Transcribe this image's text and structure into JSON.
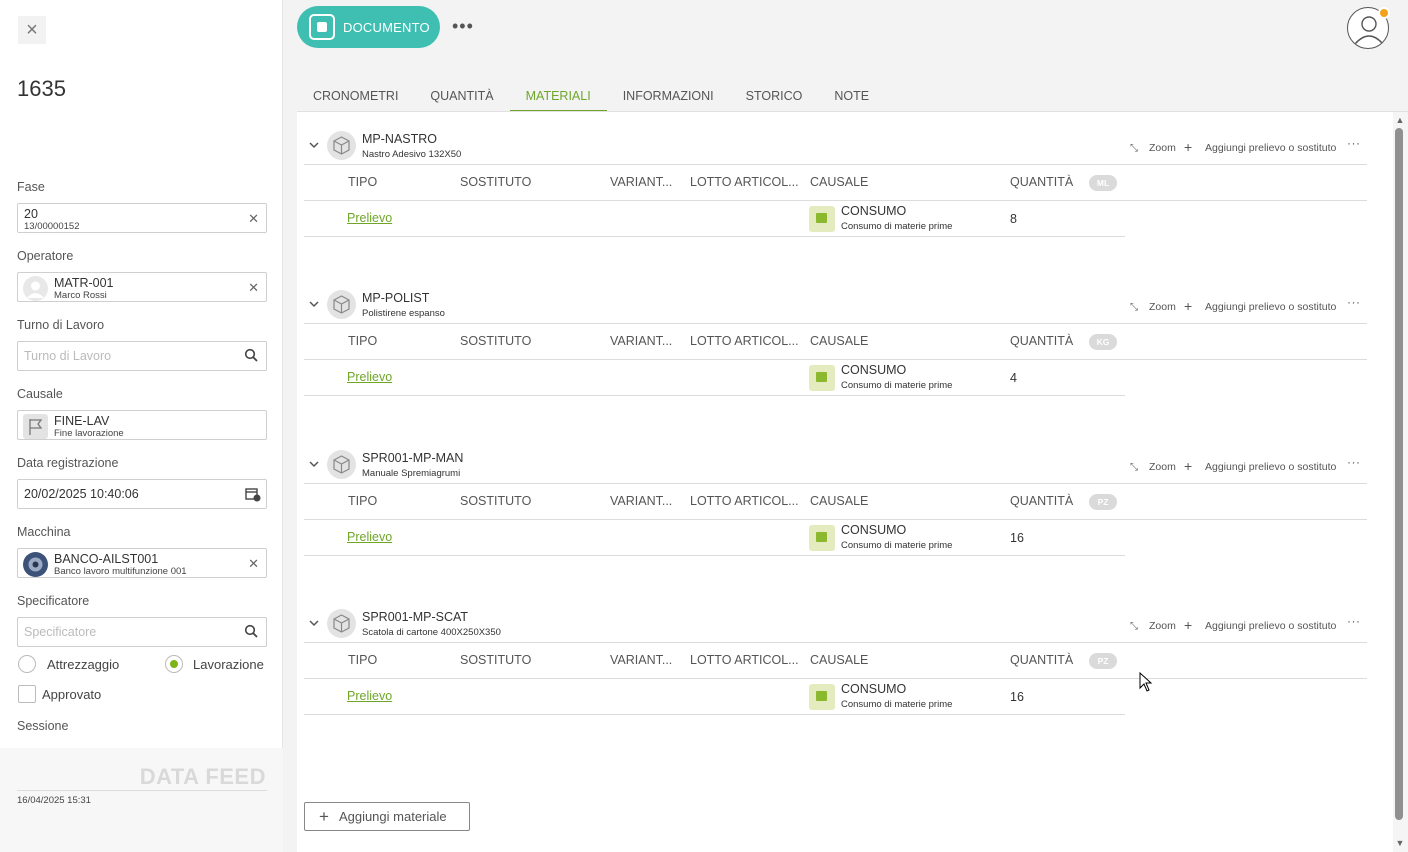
{
  "left_panel": {
    "doc_number": "1635",
    "fase": {
      "label": "Fase",
      "value": "20",
      "sub": "13/00000152"
    },
    "operatore": {
      "label": "Operatore",
      "value": "MATR-001",
      "sub": "Marco Rossi"
    },
    "turno": {
      "label": "Turno di Lavoro",
      "placeholder": "Turno di Lavoro"
    },
    "causale": {
      "label": "Causale",
      "value": "FINE-LAV",
      "sub": "Fine lavorazione"
    },
    "data_registrazione": {
      "label": "Data registrazione",
      "value": "20/02/2025 10:40:06"
    },
    "macchina": {
      "label": "Macchina",
      "value": "BANCO-AILST001",
      "sub": "Banco lavoro multifunzione 001"
    },
    "specificatore": {
      "label": "Specificatore",
      "placeholder": "Specificatore"
    },
    "radio_attrezzaggio": "Attrezzaggio",
    "radio_lavorazione": "Lavorazione",
    "approvato": "Approvato",
    "sessione": "Sessione",
    "data_feed": "DATA FEED",
    "data_feed_date": "16/04/2025 15:31"
  },
  "topbar": {
    "doc_button": "DOCUMENTO"
  },
  "tabs": [
    "CRONOMETRI",
    "QUANTITÀ",
    "MATERIALI",
    "INFORMAZIONI",
    "STORICO",
    "NOTE"
  ],
  "active_tab": "MATERIALI",
  "columns": {
    "tipo": "TIPO",
    "sostituto": "SOSTITUTO",
    "variante": "VARIANT...",
    "lotto": "LOTTO ARTICOL...",
    "causale": "CAUSALE",
    "quantita": "QUANTITÀ"
  },
  "actions": {
    "zoom": "Zoom",
    "add": "Aggiungi prelievo o sostituto"
  },
  "materials": [
    {
      "code": "MP-NASTRO",
      "desc": "Nastro Adesivo 132X50",
      "unit": "ML",
      "tipo": "Prelievo",
      "causale_code": "CONSUMO",
      "causale_desc": "Consumo di materie prime",
      "qty": "8"
    },
    {
      "code": "MP-POLIST",
      "desc": "Polistirene espanso",
      "unit": "KG",
      "tipo": "Prelievo",
      "causale_code": "CONSUMO",
      "causale_desc": "Consumo di materie prime",
      "qty": "4"
    },
    {
      "code": "SPR001-MP-MAN",
      "desc": "Manuale Spremiagrumi",
      "unit": "PZ",
      "tipo": "Prelievo",
      "causale_code": "CONSUMO",
      "causale_desc": "Consumo di materie prime",
      "qty": "16"
    },
    {
      "code": "SPR001-MP-SCAT",
      "desc": "Scatola di cartone 400X250X350",
      "unit": "PZ",
      "tipo": "Prelievo",
      "causale_code": "CONSUMO",
      "causale_desc": "Consumo di materie prime",
      "qty": "16"
    }
  ],
  "add_material": "Aggiungi materiale",
  "colors": {
    "accent_green": "#6fa62a",
    "teal": "#3fbfb2",
    "badge_orange": "#f2a21b"
  }
}
